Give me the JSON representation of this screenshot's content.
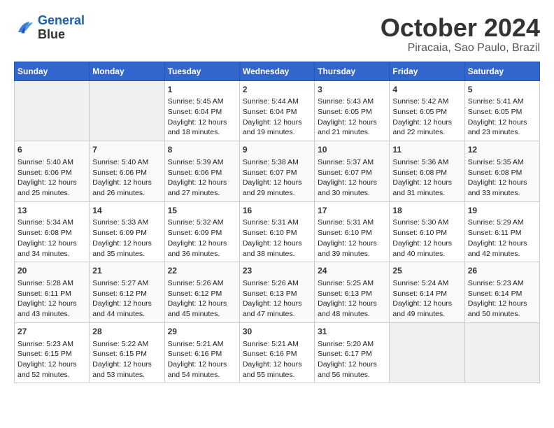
{
  "header": {
    "logo_line1": "General",
    "logo_line2": "Blue",
    "month": "October 2024",
    "location": "Piracaia, Sao Paulo, Brazil"
  },
  "weekdays": [
    "Sunday",
    "Monday",
    "Tuesday",
    "Wednesday",
    "Thursday",
    "Friday",
    "Saturday"
  ],
  "weeks": [
    [
      {
        "day": "",
        "empty": true
      },
      {
        "day": "",
        "empty": true
      },
      {
        "day": "1",
        "sunrise": "5:45 AM",
        "sunset": "6:04 PM",
        "daylight": "12 hours and 18 minutes."
      },
      {
        "day": "2",
        "sunrise": "5:44 AM",
        "sunset": "6:04 PM",
        "daylight": "12 hours and 19 minutes."
      },
      {
        "day": "3",
        "sunrise": "5:43 AM",
        "sunset": "6:05 PM",
        "daylight": "12 hours and 21 minutes."
      },
      {
        "day": "4",
        "sunrise": "5:42 AM",
        "sunset": "6:05 PM",
        "daylight": "12 hours and 22 minutes."
      },
      {
        "day": "5",
        "sunrise": "5:41 AM",
        "sunset": "6:05 PM",
        "daylight": "12 hours and 23 minutes."
      }
    ],
    [
      {
        "day": "6",
        "sunrise": "5:40 AM",
        "sunset": "6:06 PM",
        "daylight": "12 hours and 25 minutes."
      },
      {
        "day": "7",
        "sunrise": "5:40 AM",
        "sunset": "6:06 PM",
        "daylight": "12 hours and 26 minutes."
      },
      {
        "day": "8",
        "sunrise": "5:39 AM",
        "sunset": "6:06 PM",
        "daylight": "12 hours and 27 minutes."
      },
      {
        "day": "9",
        "sunrise": "5:38 AM",
        "sunset": "6:07 PM",
        "daylight": "12 hours and 29 minutes."
      },
      {
        "day": "10",
        "sunrise": "5:37 AM",
        "sunset": "6:07 PM",
        "daylight": "12 hours and 30 minutes."
      },
      {
        "day": "11",
        "sunrise": "5:36 AM",
        "sunset": "6:08 PM",
        "daylight": "12 hours and 31 minutes."
      },
      {
        "day": "12",
        "sunrise": "5:35 AM",
        "sunset": "6:08 PM",
        "daylight": "12 hours and 33 minutes."
      }
    ],
    [
      {
        "day": "13",
        "sunrise": "5:34 AM",
        "sunset": "6:08 PM",
        "daylight": "12 hours and 34 minutes."
      },
      {
        "day": "14",
        "sunrise": "5:33 AM",
        "sunset": "6:09 PM",
        "daylight": "12 hours and 35 minutes."
      },
      {
        "day": "15",
        "sunrise": "5:32 AM",
        "sunset": "6:09 PM",
        "daylight": "12 hours and 36 minutes."
      },
      {
        "day": "16",
        "sunrise": "5:31 AM",
        "sunset": "6:10 PM",
        "daylight": "12 hours and 38 minutes."
      },
      {
        "day": "17",
        "sunrise": "5:31 AM",
        "sunset": "6:10 PM",
        "daylight": "12 hours and 39 minutes."
      },
      {
        "day": "18",
        "sunrise": "5:30 AM",
        "sunset": "6:10 PM",
        "daylight": "12 hours and 40 minutes."
      },
      {
        "day": "19",
        "sunrise": "5:29 AM",
        "sunset": "6:11 PM",
        "daylight": "12 hours and 42 minutes."
      }
    ],
    [
      {
        "day": "20",
        "sunrise": "5:28 AM",
        "sunset": "6:11 PM",
        "daylight": "12 hours and 43 minutes."
      },
      {
        "day": "21",
        "sunrise": "5:27 AM",
        "sunset": "6:12 PM",
        "daylight": "12 hours and 44 minutes."
      },
      {
        "day": "22",
        "sunrise": "5:26 AM",
        "sunset": "6:12 PM",
        "daylight": "12 hours and 45 minutes."
      },
      {
        "day": "23",
        "sunrise": "5:26 AM",
        "sunset": "6:13 PM",
        "daylight": "12 hours and 47 minutes."
      },
      {
        "day": "24",
        "sunrise": "5:25 AM",
        "sunset": "6:13 PM",
        "daylight": "12 hours and 48 minutes."
      },
      {
        "day": "25",
        "sunrise": "5:24 AM",
        "sunset": "6:14 PM",
        "daylight": "12 hours and 49 minutes."
      },
      {
        "day": "26",
        "sunrise": "5:23 AM",
        "sunset": "6:14 PM",
        "daylight": "12 hours and 50 minutes."
      }
    ],
    [
      {
        "day": "27",
        "sunrise": "5:23 AM",
        "sunset": "6:15 PM",
        "daylight": "12 hours and 52 minutes."
      },
      {
        "day": "28",
        "sunrise": "5:22 AM",
        "sunset": "6:15 PM",
        "daylight": "12 hours and 53 minutes."
      },
      {
        "day": "29",
        "sunrise": "5:21 AM",
        "sunset": "6:16 PM",
        "daylight": "12 hours and 54 minutes."
      },
      {
        "day": "30",
        "sunrise": "5:21 AM",
        "sunset": "6:16 PM",
        "daylight": "12 hours and 55 minutes."
      },
      {
        "day": "31",
        "sunrise": "5:20 AM",
        "sunset": "6:17 PM",
        "daylight": "12 hours and 56 minutes."
      },
      {
        "day": "",
        "empty": true
      },
      {
        "day": "",
        "empty": true
      }
    ]
  ]
}
